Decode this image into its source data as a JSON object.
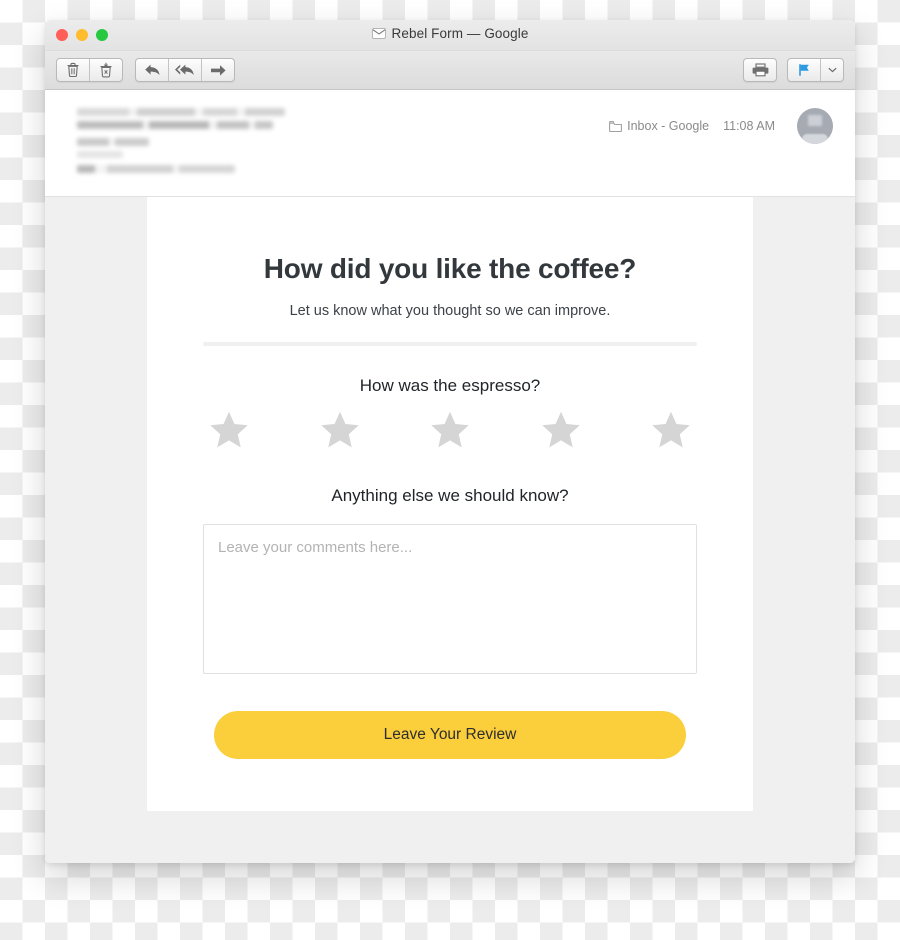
{
  "window": {
    "title": "Rebel Form — Google",
    "title_icon": "envelope-icon",
    "traffic_lights": [
      {
        "name": "close",
        "color": "#ff5f57"
      },
      {
        "name": "minimize",
        "color": "#febc2e"
      },
      {
        "name": "zoom",
        "color": "#28c840"
      }
    ]
  },
  "toolbar": {
    "left_groups": [
      {
        "buttons": [
          {
            "name": "delete-button",
            "icon": "trash-icon"
          },
          {
            "name": "junk-button",
            "icon": "junk-bin-icon"
          }
        ]
      },
      {
        "buttons": [
          {
            "name": "reply-button",
            "icon": "reply-arrow-icon"
          },
          {
            "name": "reply-all-button",
            "icon": "reply-all-arrow-icon"
          },
          {
            "name": "forward-button",
            "icon": "forward-arrow-icon"
          }
        ]
      }
    ],
    "right_groups": [
      {
        "buttons": [
          {
            "name": "print-button",
            "icon": "printer-icon"
          }
        ]
      },
      {
        "buttons": [
          {
            "name": "flag-button",
            "icon": "flag-icon",
            "color": "#2f9ae0"
          },
          {
            "name": "flag-menu-button",
            "icon": "chevron-down-icon"
          }
        ]
      }
    ]
  },
  "message_header": {
    "sender_redacted": true,
    "mailbox": "Inbox - Google",
    "mailbox_icon": "folder-icon",
    "timestamp": "11:08 AM",
    "avatar_label": "avatar"
  },
  "email": {
    "title": "How did you like the coffee?",
    "subtitle": "Let us know what you thought so we can improve.",
    "rating": {
      "question": "How was the espresso?",
      "stars_total": 5,
      "stars_filled": 0,
      "star_color": "#d5d5d5"
    },
    "comments": {
      "question": "Anything else we should know?",
      "placeholder": "Leave your comments here...",
      "value": ""
    },
    "cta": {
      "label": "Leave Your Review",
      "color": "#fbce3c"
    }
  }
}
